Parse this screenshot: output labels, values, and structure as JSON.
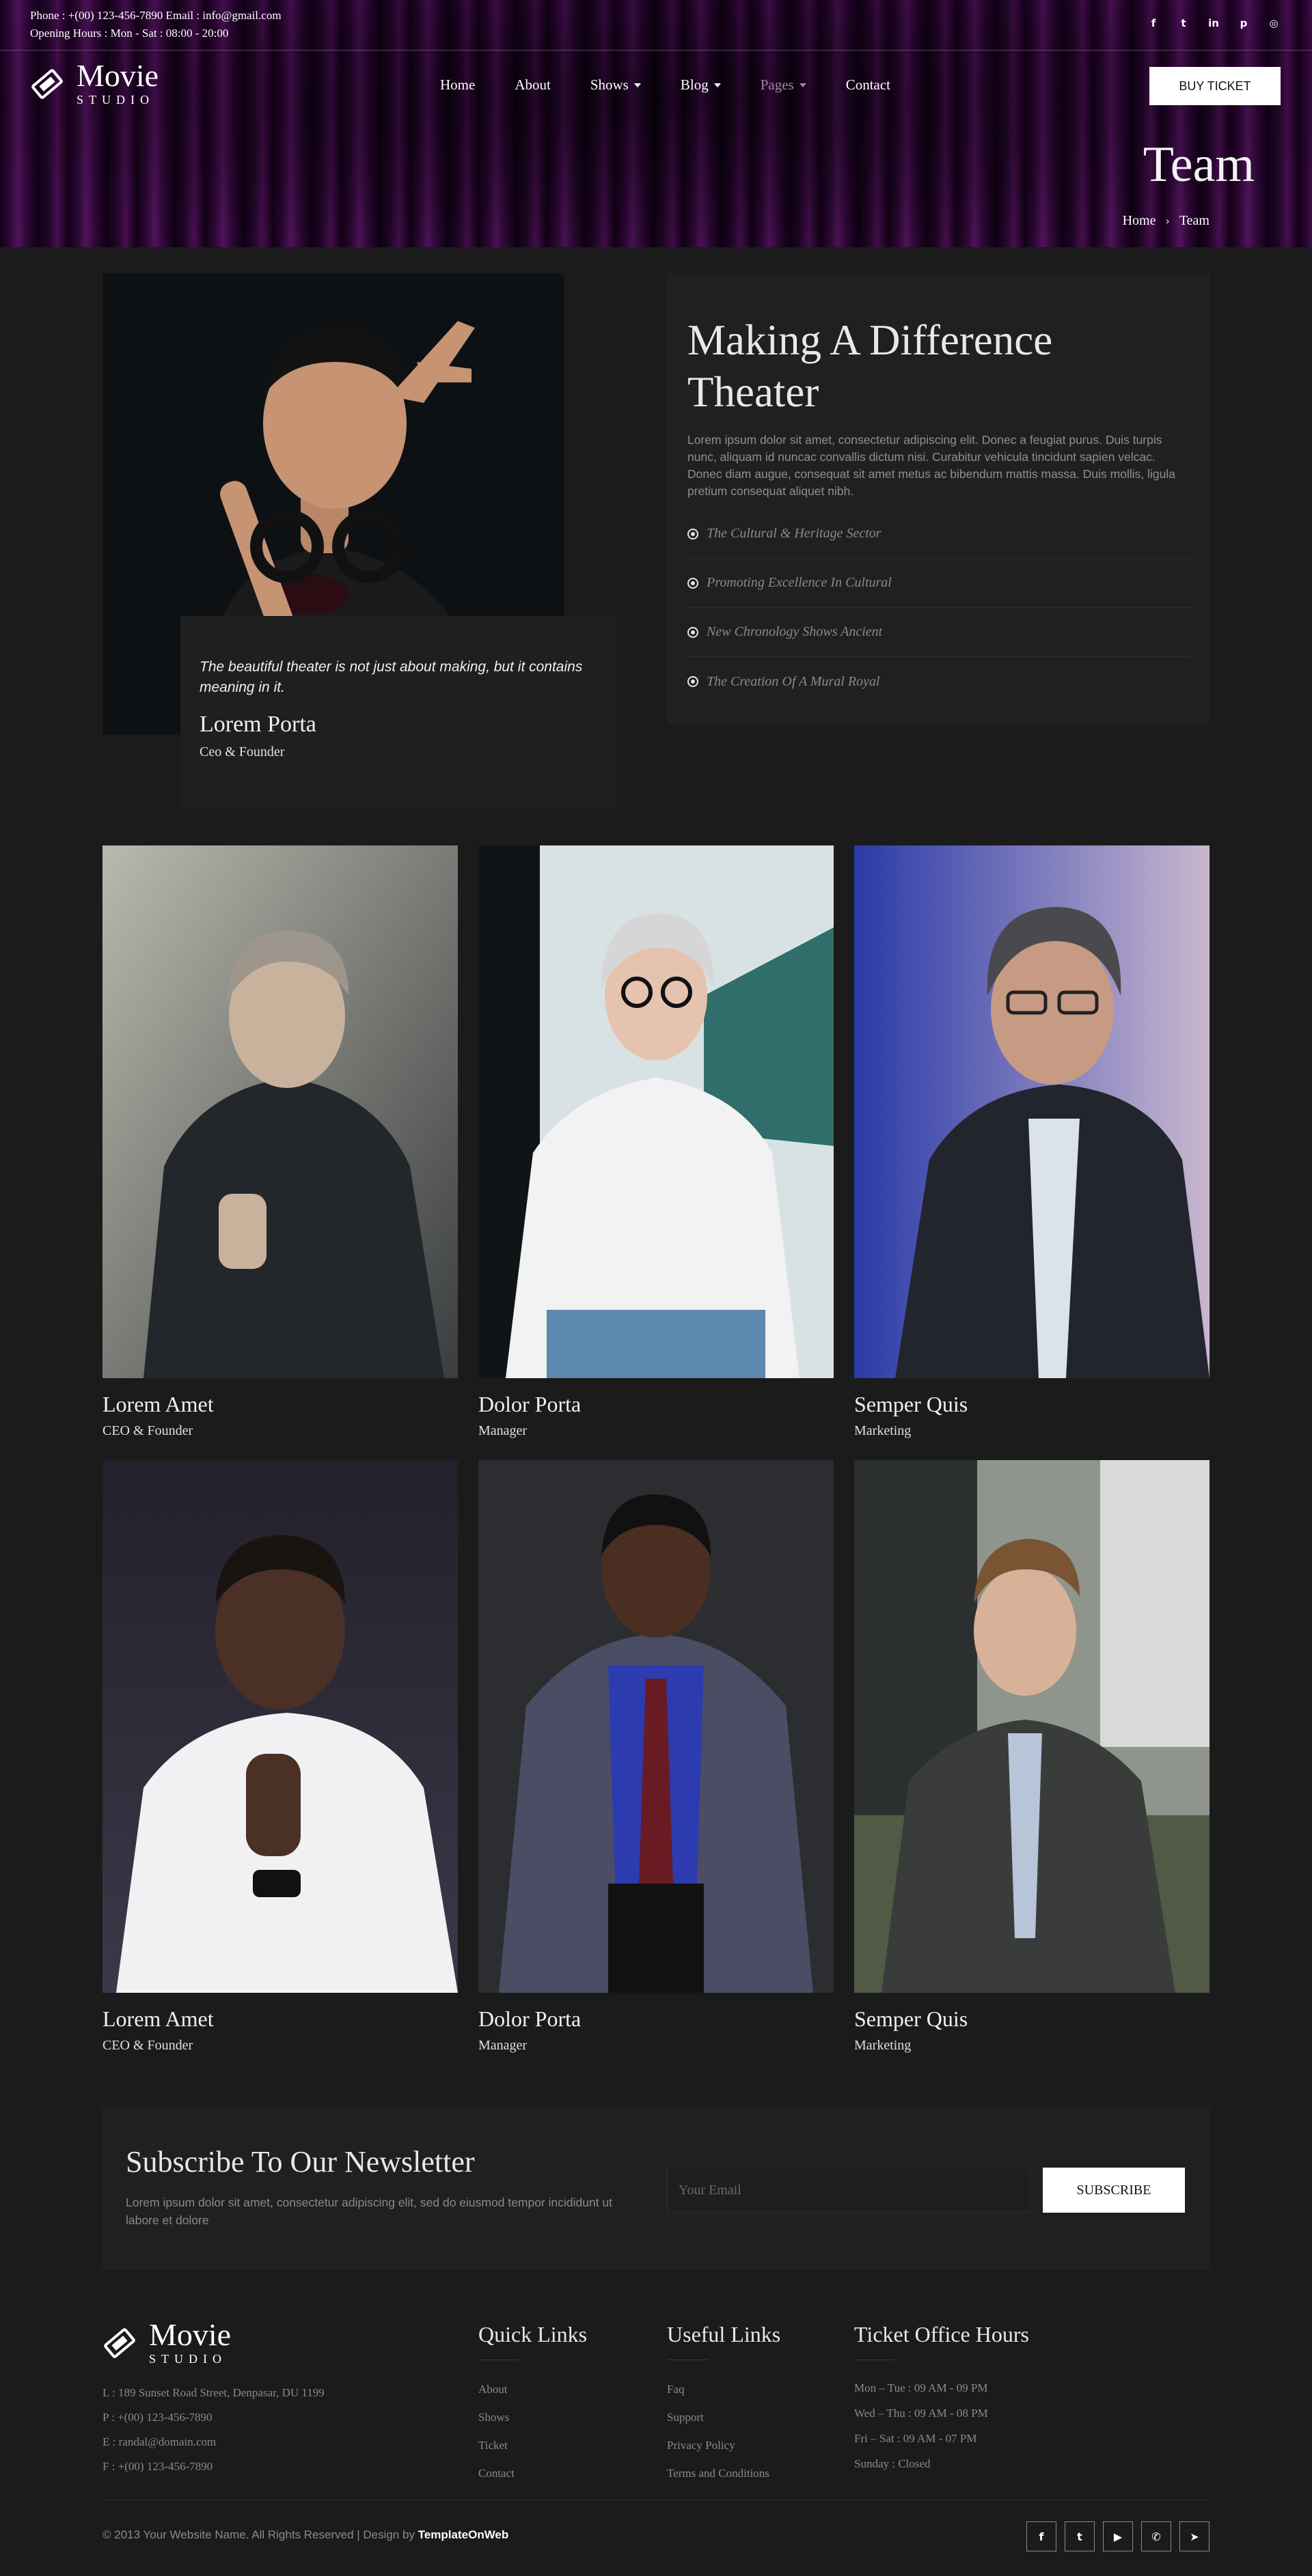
{
  "topbar": {
    "phone": "Phone : +(00) 123-456-7890   Email : info@gmail.com",
    "hours": "Opening Hours : Mon - Sat : 08:00 - 20:00",
    "social": [
      {
        "icon": "facebook-icon",
        "glyph": "f"
      },
      {
        "icon": "twitter-icon",
        "glyph": "t"
      },
      {
        "icon": "linkedin-icon",
        "glyph": "in"
      },
      {
        "icon": "pinterest-icon",
        "glyph": "p"
      },
      {
        "icon": "instagram-icon",
        "glyph": "◎"
      }
    ]
  },
  "brand": {
    "name": "Movie",
    "sub": "STUDIO"
  },
  "nav": {
    "items": [
      {
        "label": "Home",
        "caret": false,
        "muted": false
      },
      {
        "label": "About",
        "caret": false,
        "muted": false
      },
      {
        "label": "Shows",
        "caret": true,
        "muted": false
      },
      {
        "label": "Blog",
        "caret": true,
        "muted": false
      },
      {
        "label": "Pages",
        "caret": true,
        "muted": true
      },
      {
        "label": "Contact",
        "caret": false,
        "muted": false
      }
    ],
    "cta": "BUY TICKET"
  },
  "hero": {
    "title": "Team",
    "breadcrumb": [
      "Home",
      "Team"
    ]
  },
  "intro": {
    "quote": "The beautiful theater is not just about making, but it contains meaning in it.",
    "name": "Lorem Porta",
    "role": "Ceo & Founder",
    "heading": "Making A Difference Theater",
    "text": "Lorem ipsum dolor sit amet, consectetur adipiscing elit. Donec a feugiat purus. Duis turpis nunc, aliquam id nuncac convallis dictum nisi. Curabitur vehicula tincidunt sapien velcac. Donec diam augue, consequat sit amet metus ac bibendum mattis massa. Duis mollis, ligula pretium consequat aliquet nibh.",
    "bullets": [
      "The Cultural & Heritage Sector",
      "Promoting Excellence In Cultural",
      "New Chronology Shows Ancient",
      "The Creation Of A Mural Royal"
    ]
  },
  "team": [
    {
      "name": "Lorem Amet",
      "role": "CEO & Founder"
    },
    {
      "name": "Dolor Porta",
      "role": "Manager"
    },
    {
      "name": "Semper Quis",
      "role": "Marketing"
    },
    {
      "name": "Lorem Amet",
      "role": "CEO & Founder"
    },
    {
      "name": "Dolor Porta",
      "role": "Manager"
    },
    {
      "name": "Semper Quis",
      "role": "Marketing"
    }
  ],
  "newsletter": {
    "title": "Subscribe To Our Newsletter",
    "text": "Lorem ipsum dolor sit amet, consectetur adipiscing elit, sed do eiusmod tempor incididunt ut labore et dolore",
    "placeholder": "Your Email",
    "button": "SUBSCRIBE"
  },
  "footer": {
    "address": [
      "L : 189 Sunset Road Street, Denpasar, DU 1199",
      "P : +(00) 123-456-7890",
      "E : randal@domain.com",
      "F : +(00) 123-456-7890"
    ],
    "quick_links": {
      "title": "Quick Links",
      "items": [
        "About",
        "Shows",
        "Ticket",
        "Contact"
      ]
    },
    "useful_links": {
      "title": "Useful Links",
      "items": [
        "Faq",
        "Support",
        "Privacy Policy",
        "Terms and Conditions"
      ]
    },
    "hours": {
      "title": "Ticket Office Hours",
      "items": [
        "Mon – Tue : 09 AM - 09 PM",
        "Wed – Thu : 09 AM - 08 PM",
        "Fri – Sat : 09 AM - 07 PM",
        "Sunday : Closed"
      ]
    },
    "copyright": "© 2013 Your Website Name. All Rights Reserved | Design by",
    "designer": "TemplateOnWeb",
    "social": [
      {
        "icon": "facebook-icon",
        "glyph": "f"
      },
      {
        "icon": "twitter-icon",
        "glyph": "t"
      },
      {
        "icon": "youtube-icon",
        "glyph": "▶"
      },
      {
        "icon": "whatsapp-icon",
        "glyph": "✆"
      },
      {
        "icon": "telegram-icon",
        "glyph": "➤"
      }
    ]
  },
  "colors": {
    "background": "#1b1b1b",
    "card": "#202020",
    "hero_purple": "#5c1468",
    "text_muted": "#8a8a8a",
    "button": "#ffffff"
  }
}
